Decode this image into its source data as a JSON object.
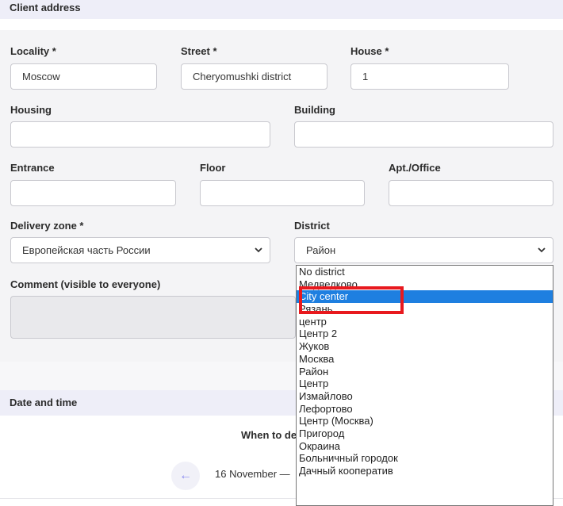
{
  "client_address": {
    "section_title": "Client address",
    "locality": {
      "label": "Locality *",
      "value": "Moscow"
    },
    "street": {
      "label": "Street *",
      "value": "Cheryomushki district"
    },
    "house": {
      "label": "House *",
      "value": "1"
    },
    "housing": {
      "label": "Housing",
      "value": ""
    },
    "building": {
      "label": "Building",
      "value": ""
    },
    "entrance": {
      "label": "Entrance",
      "value": ""
    },
    "floor": {
      "label": "Floor",
      "value": ""
    },
    "apt_office": {
      "label": "Apt./Office",
      "value": ""
    },
    "delivery_zone": {
      "label": "Delivery zone *",
      "value": "Европейская часть России"
    },
    "district": {
      "label": "District",
      "value": "Район"
    },
    "comment": {
      "label": "Comment (visible to everyone)",
      "value": ""
    }
  },
  "district_dropdown": {
    "options": [
      "No district",
      "Медведково",
      "City center",
      "Рязань",
      "центр",
      "Центр 2",
      "Жуков",
      "Москва",
      "Район",
      "Центр",
      "Измайлово",
      "Лефортово",
      "Центр (Москва)",
      "Пригород",
      "Окраина",
      "Больничный городок",
      "Дачный кооператив"
    ],
    "highlighted": "City center"
  },
  "date_time": {
    "section_title": "Date and time",
    "when_label": "When to de",
    "date_range": "16 November — ",
    "prev_arrow": "←"
  },
  "colors": {
    "selection": "#1e7fe0",
    "annotation_box": "#e8191e",
    "arrow": "#8a8af0"
  }
}
